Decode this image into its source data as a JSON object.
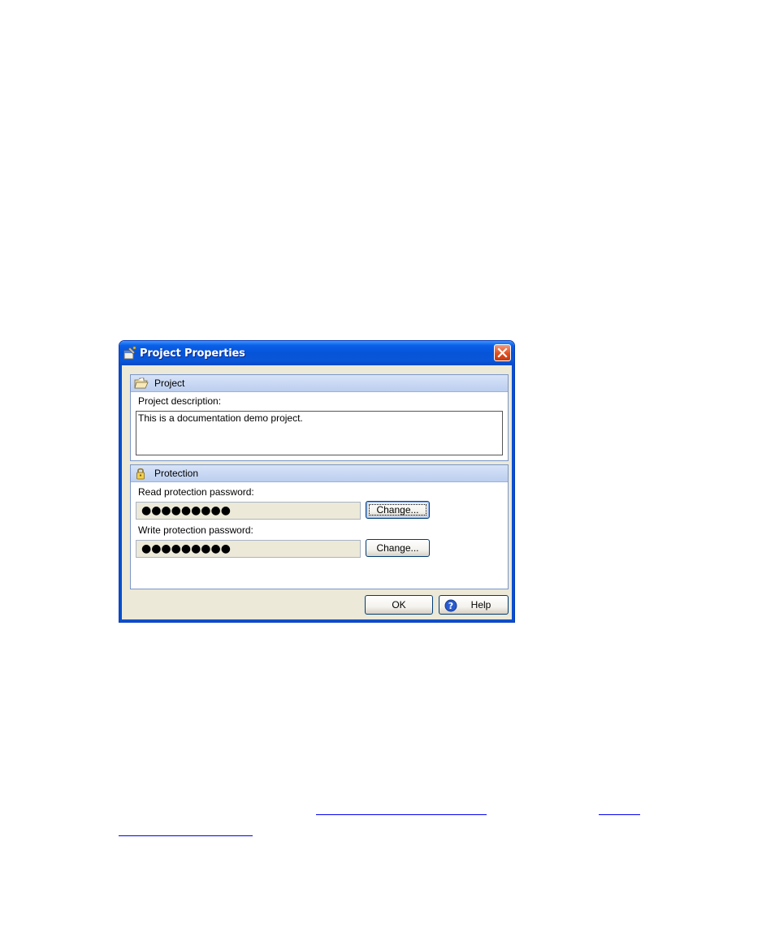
{
  "dialog": {
    "title": "Project Properties",
    "project_section": {
      "header": "Project",
      "description_label": "Project description:",
      "description_value": "This is a documentation demo project."
    },
    "protection_section": {
      "header": "Protection",
      "read_label": "Read protection password:",
      "read_value": "●●●●●●●●●",
      "read_change_label": "Change...",
      "write_label": "Write protection password:",
      "write_value": "●●●●●●●●●",
      "write_change_label": "Change..."
    },
    "ok_label": "OK",
    "help_label": "Help"
  },
  "colors": {
    "titlebar": "#0654d8",
    "dialog_bg": "#ece9d8",
    "panel_header": "#c6d6f3",
    "link": "#0000ee"
  },
  "icons": {
    "title": "properties-icon",
    "project": "folder-icon",
    "protection": "lock-icon",
    "close": "close-icon",
    "help": "help-icon"
  }
}
